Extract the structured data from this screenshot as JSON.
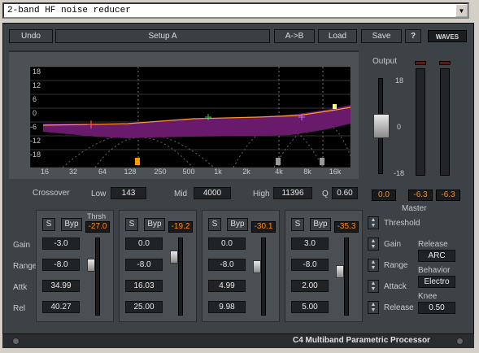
{
  "preset": {
    "value": "2-band HF noise reducer"
  },
  "toolbar": {
    "undo": "Undo",
    "setup": "Setup A",
    "ab": "A->B",
    "load": "Load",
    "save": "Save",
    "help": "?",
    "logo": "WAVES"
  },
  "graph": {
    "y_labels": [
      "18",
      "12",
      "6",
      "0",
      "-6",
      "-12",
      "-18"
    ],
    "x_labels": [
      "16",
      "32",
      "64",
      "128",
      "250",
      "500",
      "1k",
      "2k",
      "4k",
      "8k",
      "16k"
    ],
    "curve_color": "#7a1a7a",
    "line_color": "#ff9933"
  },
  "crossover": {
    "label": "Crossover",
    "low_label": "Low",
    "low": "143",
    "mid_label": "Mid",
    "mid": "4000",
    "high_label": "High",
    "high": "11396",
    "q_label": "Q",
    "q": "0.60"
  },
  "output": {
    "label": "Output",
    "scale_top": "18",
    "scale_mid": "0",
    "scale_bottom": "-18",
    "gain": "0.0",
    "meter_left": "-6.3",
    "meter_right": "-6.3"
  },
  "row_labels": {
    "gain": "Gain",
    "range": "Range",
    "attack": "Attk",
    "release": "Rel"
  },
  "bands": [
    {
      "solo": "S",
      "bypass": "Byp",
      "thrsh_label": "Thrsh",
      "thrsh": "-27.0",
      "gain": "-3.0",
      "range": "-8.0",
      "attack": "34.99",
      "release": "40.27"
    },
    {
      "solo": "S",
      "bypass": "Byp",
      "thrsh": "-19.2",
      "gain": "0.0",
      "range": "-8.0",
      "attack": "16.03",
      "release": "25.00"
    },
    {
      "solo": "S",
      "bypass": "Byp",
      "thrsh": "-30.1",
      "gain": "0.0",
      "range": "-8.0",
      "attack": "4.99",
      "release": "9.98"
    },
    {
      "solo": "S",
      "bypass": "Byp",
      "thrsh": "-35.3",
      "gain": "3.0",
      "range": "-8.0",
      "attack": "2.00",
      "release": "5.00"
    }
  ],
  "master": {
    "label": "Master",
    "threshold": "Threshold",
    "gain": "Gain",
    "range": "Range",
    "attack": "Attack",
    "release": "Release",
    "release_label": "Release",
    "release_value": "ARC",
    "behavior_label": "Behavior",
    "behavior_value": "Electro",
    "knee_label": "Knee",
    "knee_value": "0.50"
  },
  "footer": {
    "title": "C4 Multiband Parametric Processor"
  }
}
